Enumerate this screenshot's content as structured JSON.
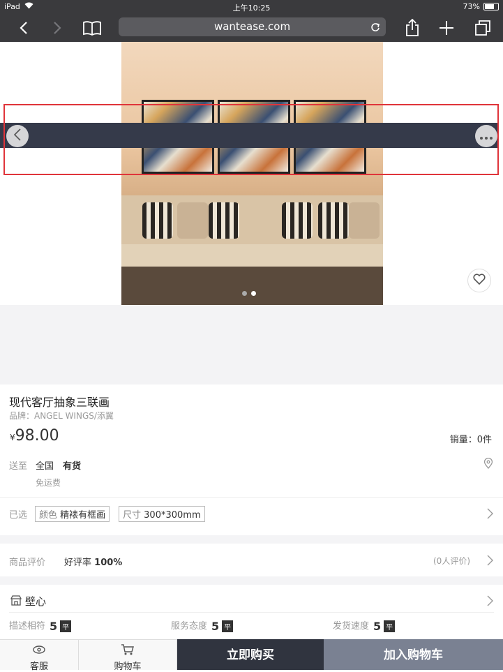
{
  "status_bar": {
    "device": "iPad",
    "time": "上午10:25",
    "battery": "73%"
  },
  "browser": {
    "url": "wantease.com"
  },
  "product": {
    "title": "现代客厅抽象三联画",
    "brand": "品牌：ANGEL WINGS/添翼",
    "currency": "¥",
    "price": "98.00",
    "sales": "销量：0件",
    "image_count": 2,
    "image_active": 2
  },
  "shipping": {
    "label": "送至",
    "region": "全国",
    "stock": "有货",
    "fee": "免运费"
  },
  "selection": {
    "label": "已选",
    "color_key": "颜色",
    "color_value": "精裱有框画",
    "size_key": "尺寸",
    "size_value": "300*300mm"
  },
  "reviews": {
    "label": "商品评价",
    "rate_label": "好评率",
    "rate_value": "100%",
    "count": "(0人评价)"
  },
  "shop": {
    "name": "壁心",
    "ratings": [
      {
        "label": "描述相符",
        "score": "5",
        "badge": "平"
      },
      {
        "label": "服务态度",
        "score": "5",
        "badge": "平"
      },
      {
        "label": "发货速度",
        "score": "5",
        "badge": "平"
      }
    ]
  },
  "bottom_bar": {
    "service": "客服",
    "cart": "购物车",
    "buy_now": "立即购买",
    "add_to_cart": "加入购物车"
  },
  "colors": {
    "toolbar": "#3a3a3d",
    "buy_button": "#30343f",
    "cart_button": "#7a8192",
    "highlight": "#e0343a",
    "overlay": "#353a4a"
  }
}
